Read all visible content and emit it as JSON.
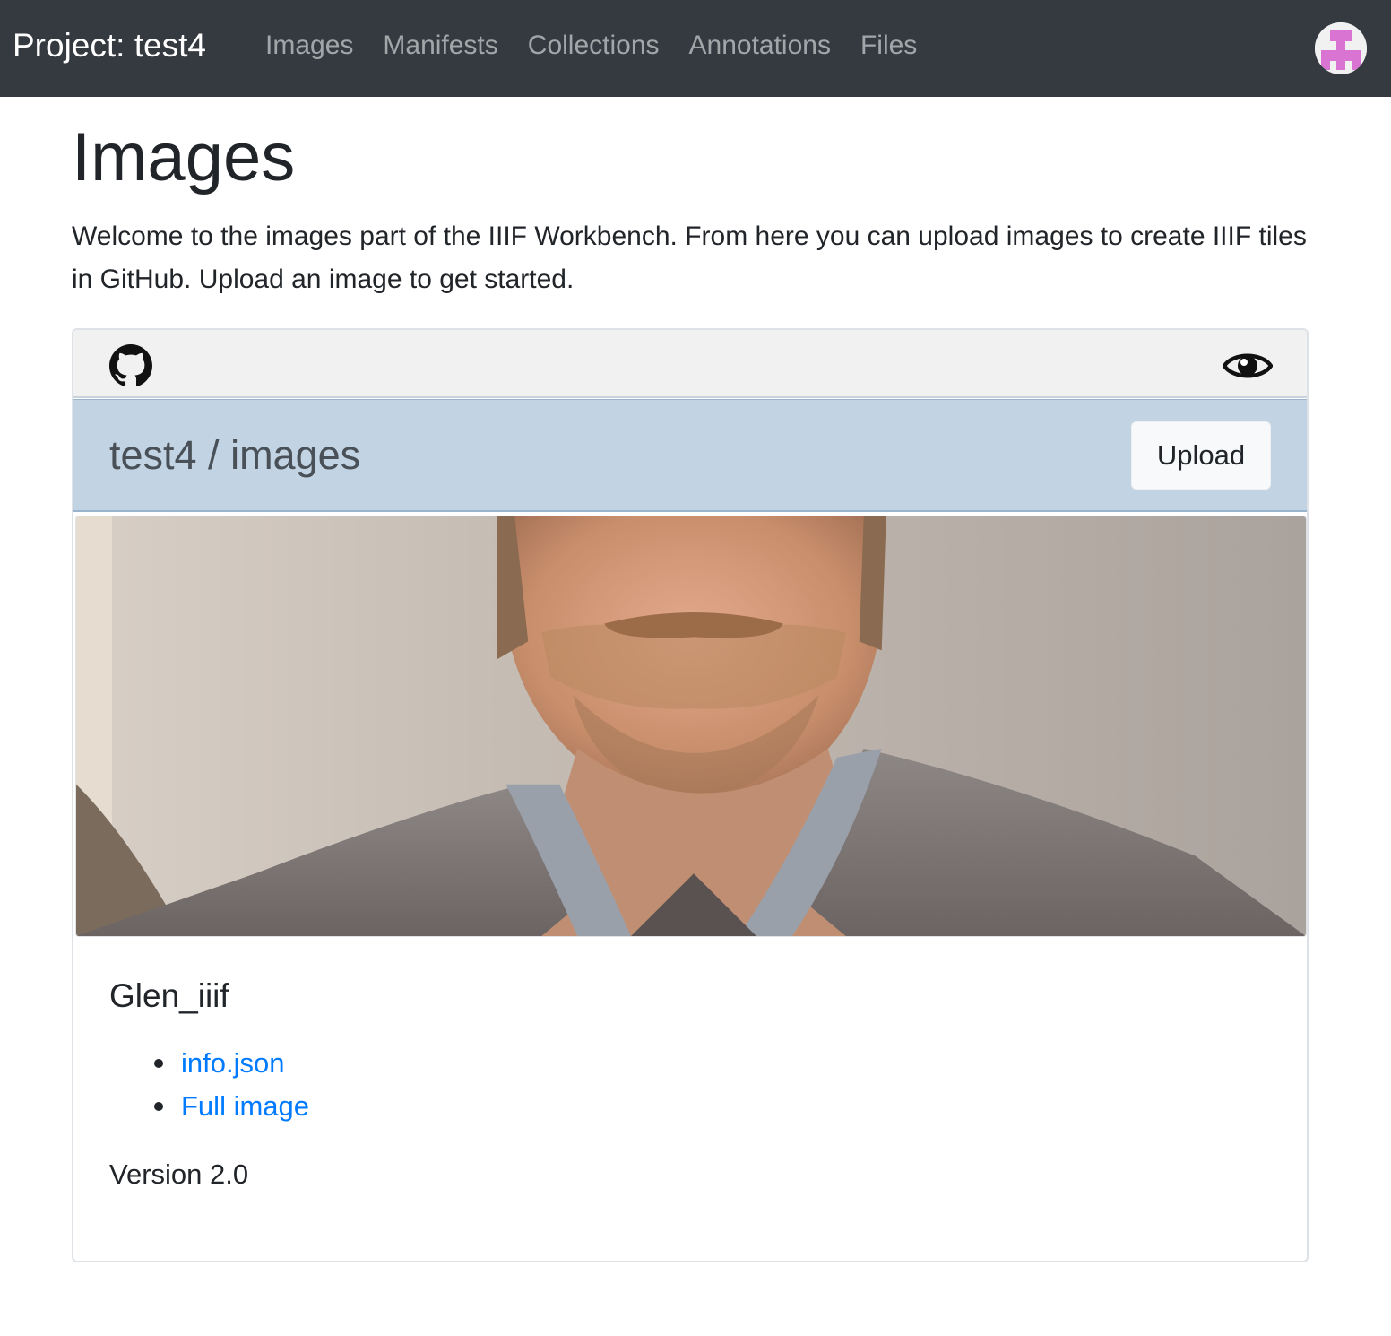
{
  "navbar": {
    "brand": "Project: test4",
    "links": [
      "Images",
      "Manifests",
      "Collections",
      "Annotations",
      "Files"
    ],
    "avatar_icon": "identicon-avatar",
    "avatar_color": "#d974d2"
  },
  "page": {
    "title": "Images",
    "intro": "Welcome to the images part of the IIIF Workbench. From here you can upload images to create IIIF tiles in GitHub. Upload an image to get started."
  },
  "card": {
    "toolbar_icons": [
      "github-icon",
      "eye-icon"
    ],
    "repo_path": "test4 / images",
    "upload_label": "Upload",
    "repo_bar_color": "#c2d4e4",
    "image": {
      "name": "Glen_iiif",
      "links": [
        "info.json",
        "Full image"
      ],
      "version": "Version 2.0"
    }
  }
}
